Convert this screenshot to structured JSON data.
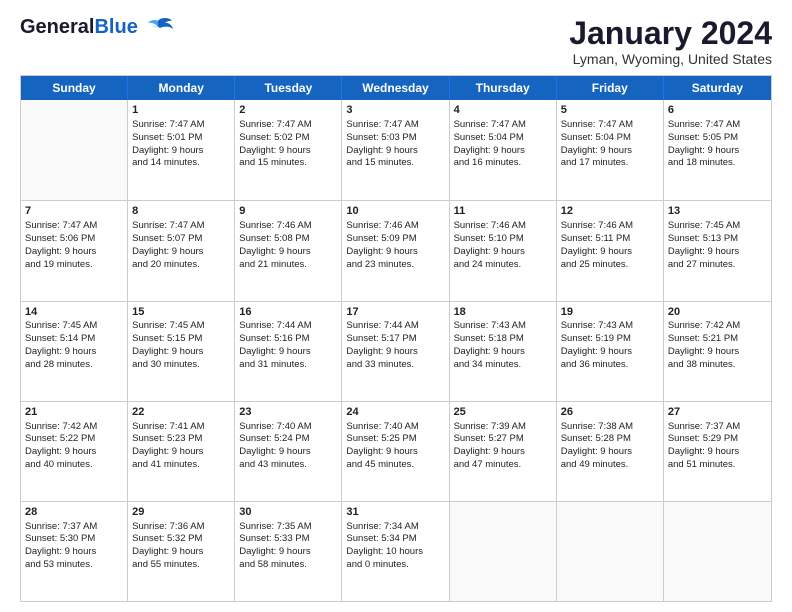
{
  "header": {
    "logo_line1": "General",
    "logo_line2": "Blue",
    "month": "January 2024",
    "location": "Lyman, Wyoming, United States"
  },
  "days": [
    "Sunday",
    "Monday",
    "Tuesday",
    "Wednesday",
    "Thursday",
    "Friday",
    "Saturday"
  ],
  "weeks": [
    [
      {
        "num": "",
        "lines": []
      },
      {
        "num": "1",
        "lines": [
          "Sunrise: 7:47 AM",
          "Sunset: 5:01 PM",
          "Daylight: 9 hours",
          "and 14 minutes."
        ]
      },
      {
        "num": "2",
        "lines": [
          "Sunrise: 7:47 AM",
          "Sunset: 5:02 PM",
          "Daylight: 9 hours",
          "and 15 minutes."
        ]
      },
      {
        "num": "3",
        "lines": [
          "Sunrise: 7:47 AM",
          "Sunset: 5:03 PM",
          "Daylight: 9 hours",
          "and 15 minutes."
        ]
      },
      {
        "num": "4",
        "lines": [
          "Sunrise: 7:47 AM",
          "Sunset: 5:04 PM",
          "Daylight: 9 hours",
          "and 16 minutes."
        ]
      },
      {
        "num": "5",
        "lines": [
          "Sunrise: 7:47 AM",
          "Sunset: 5:04 PM",
          "Daylight: 9 hours",
          "and 17 minutes."
        ]
      },
      {
        "num": "6",
        "lines": [
          "Sunrise: 7:47 AM",
          "Sunset: 5:05 PM",
          "Daylight: 9 hours",
          "and 18 minutes."
        ]
      }
    ],
    [
      {
        "num": "7",
        "lines": [
          "Sunrise: 7:47 AM",
          "Sunset: 5:06 PM",
          "Daylight: 9 hours",
          "and 19 minutes."
        ]
      },
      {
        "num": "8",
        "lines": [
          "Sunrise: 7:47 AM",
          "Sunset: 5:07 PM",
          "Daylight: 9 hours",
          "and 20 minutes."
        ]
      },
      {
        "num": "9",
        "lines": [
          "Sunrise: 7:46 AM",
          "Sunset: 5:08 PM",
          "Daylight: 9 hours",
          "and 21 minutes."
        ]
      },
      {
        "num": "10",
        "lines": [
          "Sunrise: 7:46 AM",
          "Sunset: 5:09 PM",
          "Daylight: 9 hours",
          "and 23 minutes."
        ]
      },
      {
        "num": "11",
        "lines": [
          "Sunrise: 7:46 AM",
          "Sunset: 5:10 PM",
          "Daylight: 9 hours",
          "and 24 minutes."
        ]
      },
      {
        "num": "12",
        "lines": [
          "Sunrise: 7:46 AM",
          "Sunset: 5:11 PM",
          "Daylight: 9 hours",
          "and 25 minutes."
        ]
      },
      {
        "num": "13",
        "lines": [
          "Sunrise: 7:45 AM",
          "Sunset: 5:13 PM",
          "Daylight: 9 hours",
          "and 27 minutes."
        ]
      }
    ],
    [
      {
        "num": "14",
        "lines": [
          "Sunrise: 7:45 AM",
          "Sunset: 5:14 PM",
          "Daylight: 9 hours",
          "and 28 minutes."
        ]
      },
      {
        "num": "15",
        "lines": [
          "Sunrise: 7:45 AM",
          "Sunset: 5:15 PM",
          "Daylight: 9 hours",
          "and 30 minutes."
        ]
      },
      {
        "num": "16",
        "lines": [
          "Sunrise: 7:44 AM",
          "Sunset: 5:16 PM",
          "Daylight: 9 hours",
          "and 31 minutes."
        ]
      },
      {
        "num": "17",
        "lines": [
          "Sunrise: 7:44 AM",
          "Sunset: 5:17 PM",
          "Daylight: 9 hours",
          "and 33 minutes."
        ]
      },
      {
        "num": "18",
        "lines": [
          "Sunrise: 7:43 AM",
          "Sunset: 5:18 PM",
          "Daylight: 9 hours",
          "and 34 minutes."
        ]
      },
      {
        "num": "19",
        "lines": [
          "Sunrise: 7:43 AM",
          "Sunset: 5:19 PM",
          "Daylight: 9 hours",
          "and 36 minutes."
        ]
      },
      {
        "num": "20",
        "lines": [
          "Sunrise: 7:42 AM",
          "Sunset: 5:21 PM",
          "Daylight: 9 hours",
          "and 38 minutes."
        ]
      }
    ],
    [
      {
        "num": "21",
        "lines": [
          "Sunrise: 7:42 AM",
          "Sunset: 5:22 PM",
          "Daylight: 9 hours",
          "and 40 minutes."
        ]
      },
      {
        "num": "22",
        "lines": [
          "Sunrise: 7:41 AM",
          "Sunset: 5:23 PM",
          "Daylight: 9 hours",
          "and 41 minutes."
        ]
      },
      {
        "num": "23",
        "lines": [
          "Sunrise: 7:40 AM",
          "Sunset: 5:24 PM",
          "Daylight: 9 hours",
          "and 43 minutes."
        ]
      },
      {
        "num": "24",
        "lines": [
          "Sunrise: 7:40 AM",
          "Sunset: 5:25 PM",
          "Daylight: 9 hours",
          "and 45 minutes."
        ]
      },
      {
        "num": "25",
        "lines": [
          "Sunrise: 7:39 AM",
          "Sunset: 5:27 PM",
          "Daylight: 9 hours",
          "and 47 minutes."
        ]
      },
      {
        "num": "26",
        "lines": [
          "Sunrise: 7:38 AM",
          "Sunset: 5:28 PM",
          "Daylight: 9 hours",
          "and 49 minutes."
        ]
      },
      {
        "num": "27",
        "lines": [
          "Sunrise: 7:37 AM",
          "Sunset: 5:29 PM",
          "Daylight: 9 hours",
          "and 51 minutes."
        ]
      }
    ],
    [
      {
        "num": "28",
        "lines": [
          "Sunrise: 7:37 AM",
          "Sunset: 5:30 PM",
          "Daylight: 9 hours",
          "and 53 minutes."
        ]
      },
      {
        "num": "29",
        "lines": [
          "Sunrise: 7:36 AM",
          "Sunset: 5:32 PM",
          "Daylight: 9 hours",
          "and 55 minutes."
        ]
      },
      {
        "num": "30",
        "lines": [
          "Sunrise: 7:35 AM",
          "Sunset: 5:33 PM",
          "Daylight: 9 hours",
          "and 58 minutes."
        ]
      },
      {
        "num": "31",
        "lines": [
          "Sunrise: 7:34 AM",
          "Sunset: 5:34 PM",
          "Daylight: 10 hours",
          "and 0 minutes."
        ]
      },
      {
        "num": "",
        "lines": []
      },
      {
        "num": "",
        "lines": []
      },
      {
        "num": "",
        "lines": []
      }
    ]
  ]
}
